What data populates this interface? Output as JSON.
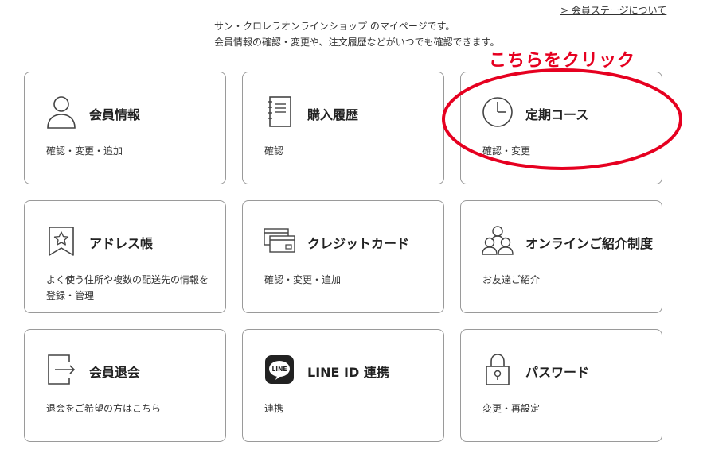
{
  "header": {
    "stage_link": "> 会員ステージについて",
    "intro_line1": "サン・クロレラオンラインショップ のマイページです。",
    "intro_line2": "会員情報の確認・変更や、注文履歴などがいつでも確認できます。"
  },
  "annotation": {
    "text": "こちらをクリック",
    "color": "#e60020"
  },
  "cards": [
    {
      "icon": "person-icon",
      "title": "会員情報",
      "desc": "確認・変更・追加"
    },
    {
      "icon": "notebook-icon",
      "title": "購入履歴",
      "desc": "確認"
    },
    {
      "icon": "clock-icon",
      "title": "定期コース",
      "desc": "確認・変更"
    },
    {
      "icon": "star-bookmark-icon",
      "title": "アドレス帳",
      "desc": "よく使う住所や複数の配送先の情報を登録・管理"
    },
    {
      "icon": "credit-card-icon",
      "title": "クレジットカード",
      "desc": "確認・変更・追加"
    },
    {
      "icon": "people-group-icon",
      "title": "オンラインご紹介制度",
      "desc": "お友達ご紹介"
    },
    {
      "icon": "exit-icon",
      "title": "会員退会",
      "desc": "退会をご希望の方はこちら"
    },
    {
      "icon": "line-icon",
      "title": "LINE ID 連携",
      "desc": "連携",
      "icon_text": "LINE"
    },
    {
      "icon": "lock-icon",
      "title": "パスワード",
      "desc": "変更・再設定"
    }
  ]
}
